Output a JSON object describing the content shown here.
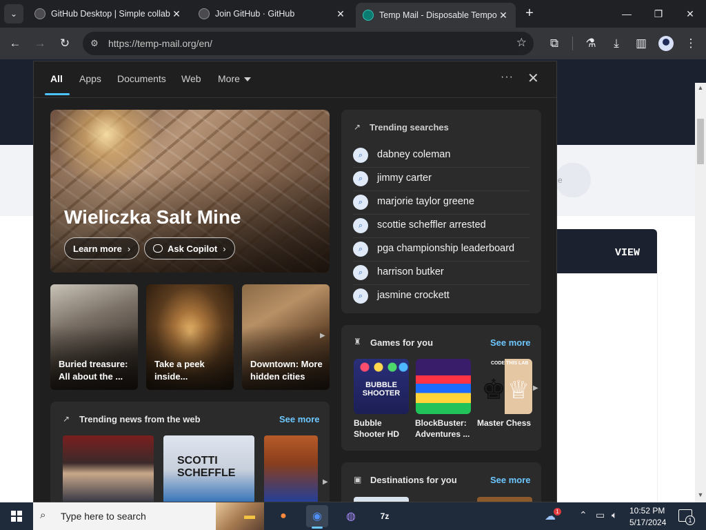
{
  "browser": {
    "tabs": [
      {
        "title": "GitHub Desktop | Simple collab",
        "close": "✕"
      },
      {
        "title": "Join GitHub · GitHub",
        "close": "✕"
      },
      {
        "title": "Temp Mail - Disposable Tempo",
        "close": "✕"
      }
    ],
    "url": "https://temp-mail.org/en/",
    "new_tab": "+"
  },
  "page_behind": {
    "view_label": "VIEW",
    "pill_text": "e"
  },
  "flyout": {
    "nav": [
      {
        "label": "All"
      },
      {
        "label": "Apps"
      },
      {
        "label": "Documents"
      },
      {
        "label": "Web"
      },
      {
        "label": "More"
      }
    ],
    "dots": "···",
    "close": "✕",
    "hero": {
      "title": "Wieliczka Salt Mine",
      "learn_more": "Learn more",
      "ask_copilot": "Ask Copilot"
    },
    "stories": [
      {
        "text": "Buried treasure: All about the ..."
      },
      {
        "text": "Take a peek inside..."
      },
      {
        "text": "Downtown: More hidden cities"
      }
    ],
    "trending_searches": {
      "title": "Trending searches",
      "items": [
        "dabney coleman",
        "jimmy carter",
        "marjorie taylor greene",
        "scottie scheffler arrested",
        "pga championship leaderboard",
        "harrison butker",
        "jasmine crockett"
      ]
    },
    "games": {
      "title": "Games for you",
      "see_more": "See more",
      "items": [
        {
          "name": "Bubble Shooter HD",
          "tile_text": "BUBBLE SHOOTER"
        },
        {
          "name": "BlockBuster: Adventures ...",
          "tile_text": ""
        },
        {
          "name": "Master Chess",
          "tile_text": "CODE THIS LAB"
        }
      ]
    },
    "news": {
      "title": "Trending news from the web",
      "see_more": "See more",
      "img2_text": "SCOTTI SCHEFFLE"
    },
    "destinations": {
      "title": "Destinations for you",
      "see_more": "See more"
    }
  },
  "taskbar": {
    "search_placeholder": "Type here to search",
    "time": "10:52 PM",
    "date": "5/17/2024",
    "notification_count": "1",
    "weather_badge": "1"
  },
  "colors": {
    "accent": "#4cc2ff",
    "link": "#6cc7ff",
    "flyout_bg": "#1f1f1f",
    "card_bg": "#2b2b2b"
  }
}
